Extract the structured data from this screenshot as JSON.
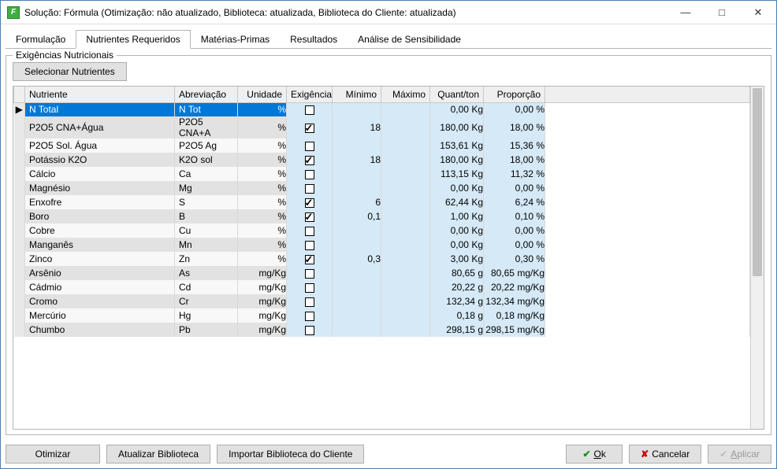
{
  "window": {
    "title": "Solução: Fórmula (Otimização: não atualizado, Biblioteca: atualizada, Biblioteca do Cliente: atualizada)"
  },
  "tabs": [
    {
      "label": "Formulação",
      "active": false
    },
    {
      "label": "Nutrientes Requeridos",
      "active": true
    },
    {
      "label": "Matérias-Primas",
      "active": false
    },
    {
      "label": "Resultados",
      "active": false
    },
    {
      "label": "Análise de Sensibilidade",
      "active": false
    }
  ],
  "fieldset": {
    "legend": "Exigências Nutricionais",
    "select_button": "Selecionar Nutrientes"
  },
  "columns": {
    "nutriente": "Nutriente",
    "abreviacao": "Abreviação",
    "unidade": "Unidade",
    "exigencia": "Exigência",
    "minimo": "Mínimo",
    "maximo": "Máximo",
    "quant": "Quant/ton",
    "proporcao": "Proporção"
  },
  "rows": [
    {
      "nutriente": "N Total",
      "abrev": "N Tot",
      "unidade": "%",
      "exig": false,
      "min": "",
      "max": "",
      "quant": "0,00 Kg",
      "prop": "0,00 %",
      "selected": true
    },
    {
      "nutriente": "P2O5 CNA+Água",
      "abrev": "P2O5 CNA+A",
      "unidade": "%",
      "exig": true,
      "min": "18",
      "max": "",
      "quant": "180,00 Kg",
      "prop": "18,00 %"
    },
    {
      "nutriente": "P2O5 Sol. Água",
      "abrev": "P2O5 Ag",
      "unidade": "%",
      "exig": false,
      "min": "",
      "max": "",
      "quant": "153,61 Kg",
      "prop": "15,36 %"
    },
    {
      "nutriente": "Potássio K2O",
      "abrev": "K2O sol",
      "unidade": "%",
      "exig": true,
      "min": "18",
      "max": "",
      "quant": "180,00 Kg",
      "prop": "18,00 %"
    },
    {
      "nutriente": "Cálcio",
      "abrev": "Ca",
      "unidade": "%",
      "exig": false,
      "min": "",
      "max": "",
      "quant": "113,15 Kg",
      "prop": "11,32 %"
    },
    {
      "nutriente": "Magnésio",
      "abrev": "Mg",
      "unidade": "%",
      "exig": false,
      "min": "",
      "max": "",
      "quant": "0,00 Kg",
      "prop": "0,00 %"
    },
    {
      "nutriente": "Enxofre",
      "abrev": "S",
      "unidade": "%",
      "exig": true,
      "min": "6",
      "max": "",
      "quant": "62,44 Kg",
      "prop": "6,24 %"
    },
    {
      "nutriente": "Boro",
      "abrev": "B",
      "unidade": "%",
      "exig": true,
      "min": "0,1",
      "max": "",
      "quant": "1,00 Kg",
      "prop": "0,10 %"
    },
    {
      "nutriente": "Cobre",
      "abrev": "Cu",
      "unidade": "%",
      "exig": false,
      "min": "",
      "max": "",
      "quant": "0,00 Kg",
      "prop": "0,00 %"
    },
    {
      "nutriente": "Manganês",
      "abrev": "Mn",
      "unidade": "%",
      "exig": false,
      "min": "",
      "max": "",
      "quant": "0,00 Kg",
      "prop": "0,00 %"
    },
    {
      "nutriente": "Zinco",
      "abrev": "Zn",
      "unidade": "%",
      "exig": true,
      "min": "0,3",
      "max": "",
      "quant": "3,00 Kg",
      "prop": "0,30 %"
    },
    {
      "nutriente": "Arsênio",
      "abrev": "As",
      "unidade": "mg/Kg",
      "exig": false,
      "min": "",
      "max": "",
      "quant": "80,65 g",
      "prop": "80,65 mg/Kg"
    },
    {
      "nutriente": "Cádmio",
      "abrev": "Cd",
      "unidade": "mg/Kg",
      "exig": false,
      "min": "",
      "max": "",
      "quant": "20,22 g",
      "prop": "20,22 mg/Kg"
    },
    {
      "nutriente": "Cromo",
      "abrev": "Cr",
      "unidade": "mg/Kg",
      "exig": false,
      "min": "",
      "max": "",
      "quant": "132,34 g",
      "prop": "132,34 mg/Kg"
    },
    {
      "nutriente": "Mercúrio",
      "abrev": "Hg",
      "unidade": "mg/Kg",
      "exig": false,
      "min": "",
      "max": "",
      "quant": "0,18 g",
      "prop": "0,18 mg/Kg"
    },
    {
      "nutriente": "Chumbo",
      "abrev": "Pb",
      "unidade": "mg/Kg",
      "exig": false,
      "min": "",
      "max": "",
      "quant": "298,15 g",
      "prop": "298,15 mg/Kg"
    }
  ],
  "footer": {
    "otimizar": "Otimizar",
    "atualizar": "Atualizar Biblioteca",
    "importar": "Importar Biblioteca do Cliente",
    "ok": "Ok",
    "cancelar": "Cancelar",
    "aplicar": "Aplicar"
  }
}
